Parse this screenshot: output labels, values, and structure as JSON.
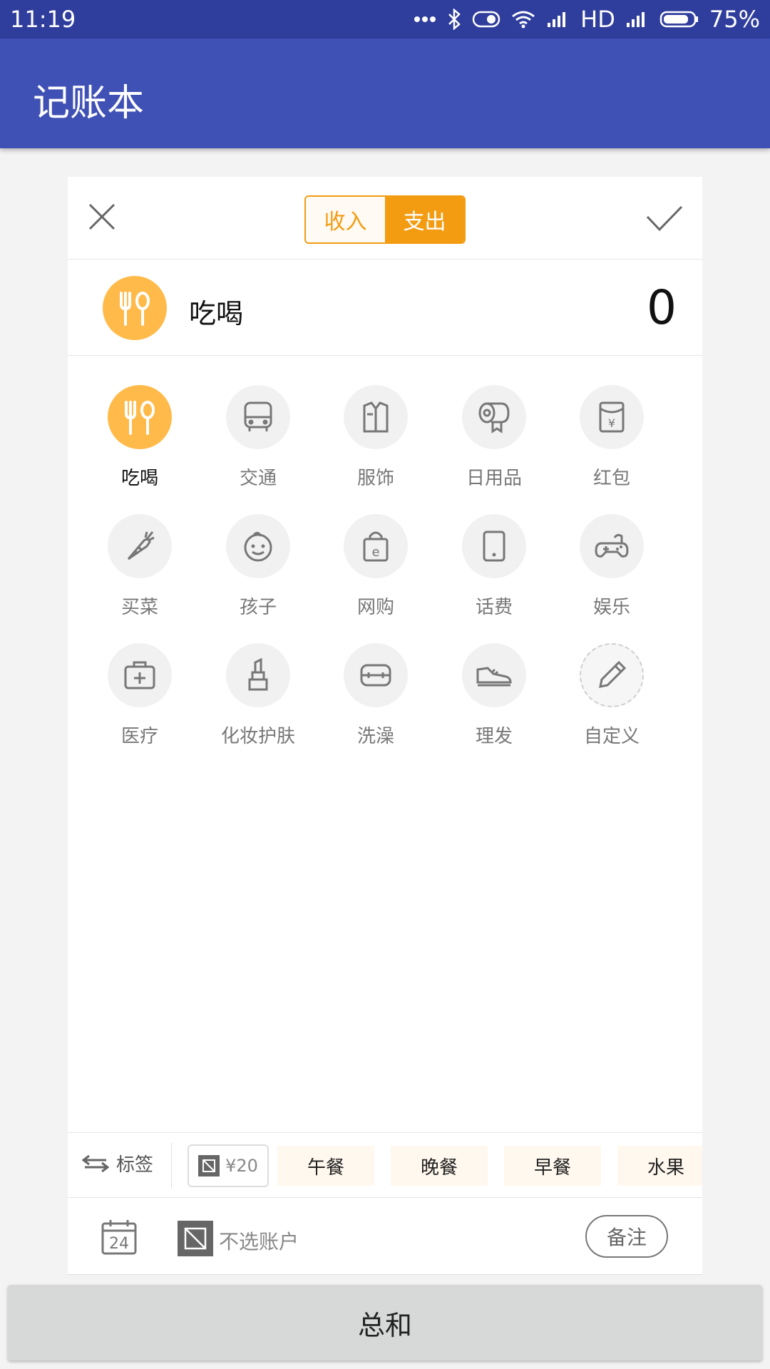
{
  "status_bar": {
    "time": "11:19",
    "network": "HD",
    "battery": "75%"
  },
  "app_bar": {
    "title": "记账本"
  },
  "segment": {
    "income": "收入",
    "expense": "支出",
    "active": "expense"
  },
  "selected": {
    "name": "吃喝",
    "amount": "0",
    "icon": "cutlery-icon"
  },
  "categories": [
    {
      "label": "吃喝",
      "icon": "cutlery-icon",
      "active": true
    },
    {
      "label": "交通",
      "icon": "bus-icon"
    },
    {
      "label": "服饰",
      "icon": "shirt-icon"
    },
    {
      "label": "日用品",
      "icon": "tissue-roll-icon"
    },
    {
      "label": "红包",
      "icon": "red-envelope-icon"
    },
    {
      "label": "买菜",
      "icon": "carrot-icon"
    },
    {
      "label": "孩子",
      "icon": "baby-face-icon"
    },
    {
      "label": "网购",
      "icon": "shopping-bag-icon"
    },
    {
      "label": "话费",
      "icon": "phone-icon"
    },
    {
      "label": "娱乐",
      "icon": "gamepad-icon"
    },
    {
      "label": "医疗",
      "icon": "medical-kit-icon"
    },
    {
      "label": "化妆护肤",
      "icon": "lipstick-icon"
    },
    {
      "label": "洗澡",
      "icon": "bath-icon"
    },
    {
      "label": "理发",
      "icon": "shoe-icon"
    },
    {
      "label": "自定义",
      "icon": "pencil-icon"
    }
  ],
  "tags": {
    "label": "标签",
    "money": "¥20",
    "chips": [
      "午餐",
      "晚餐",
      "早餐",
      "水果"
    ]
  },
  "bottom": {
    "date_day": "24",
    "account": "不选账户",
    "note": "备注"
  },
  "total_button": "总和",
  "colors": {
    "primary": "#3f51b5",
    "status": "#2f3d9c",
    "accent": "#f39c12",
    "selected_circle": "#ffba4a"
  }
}
